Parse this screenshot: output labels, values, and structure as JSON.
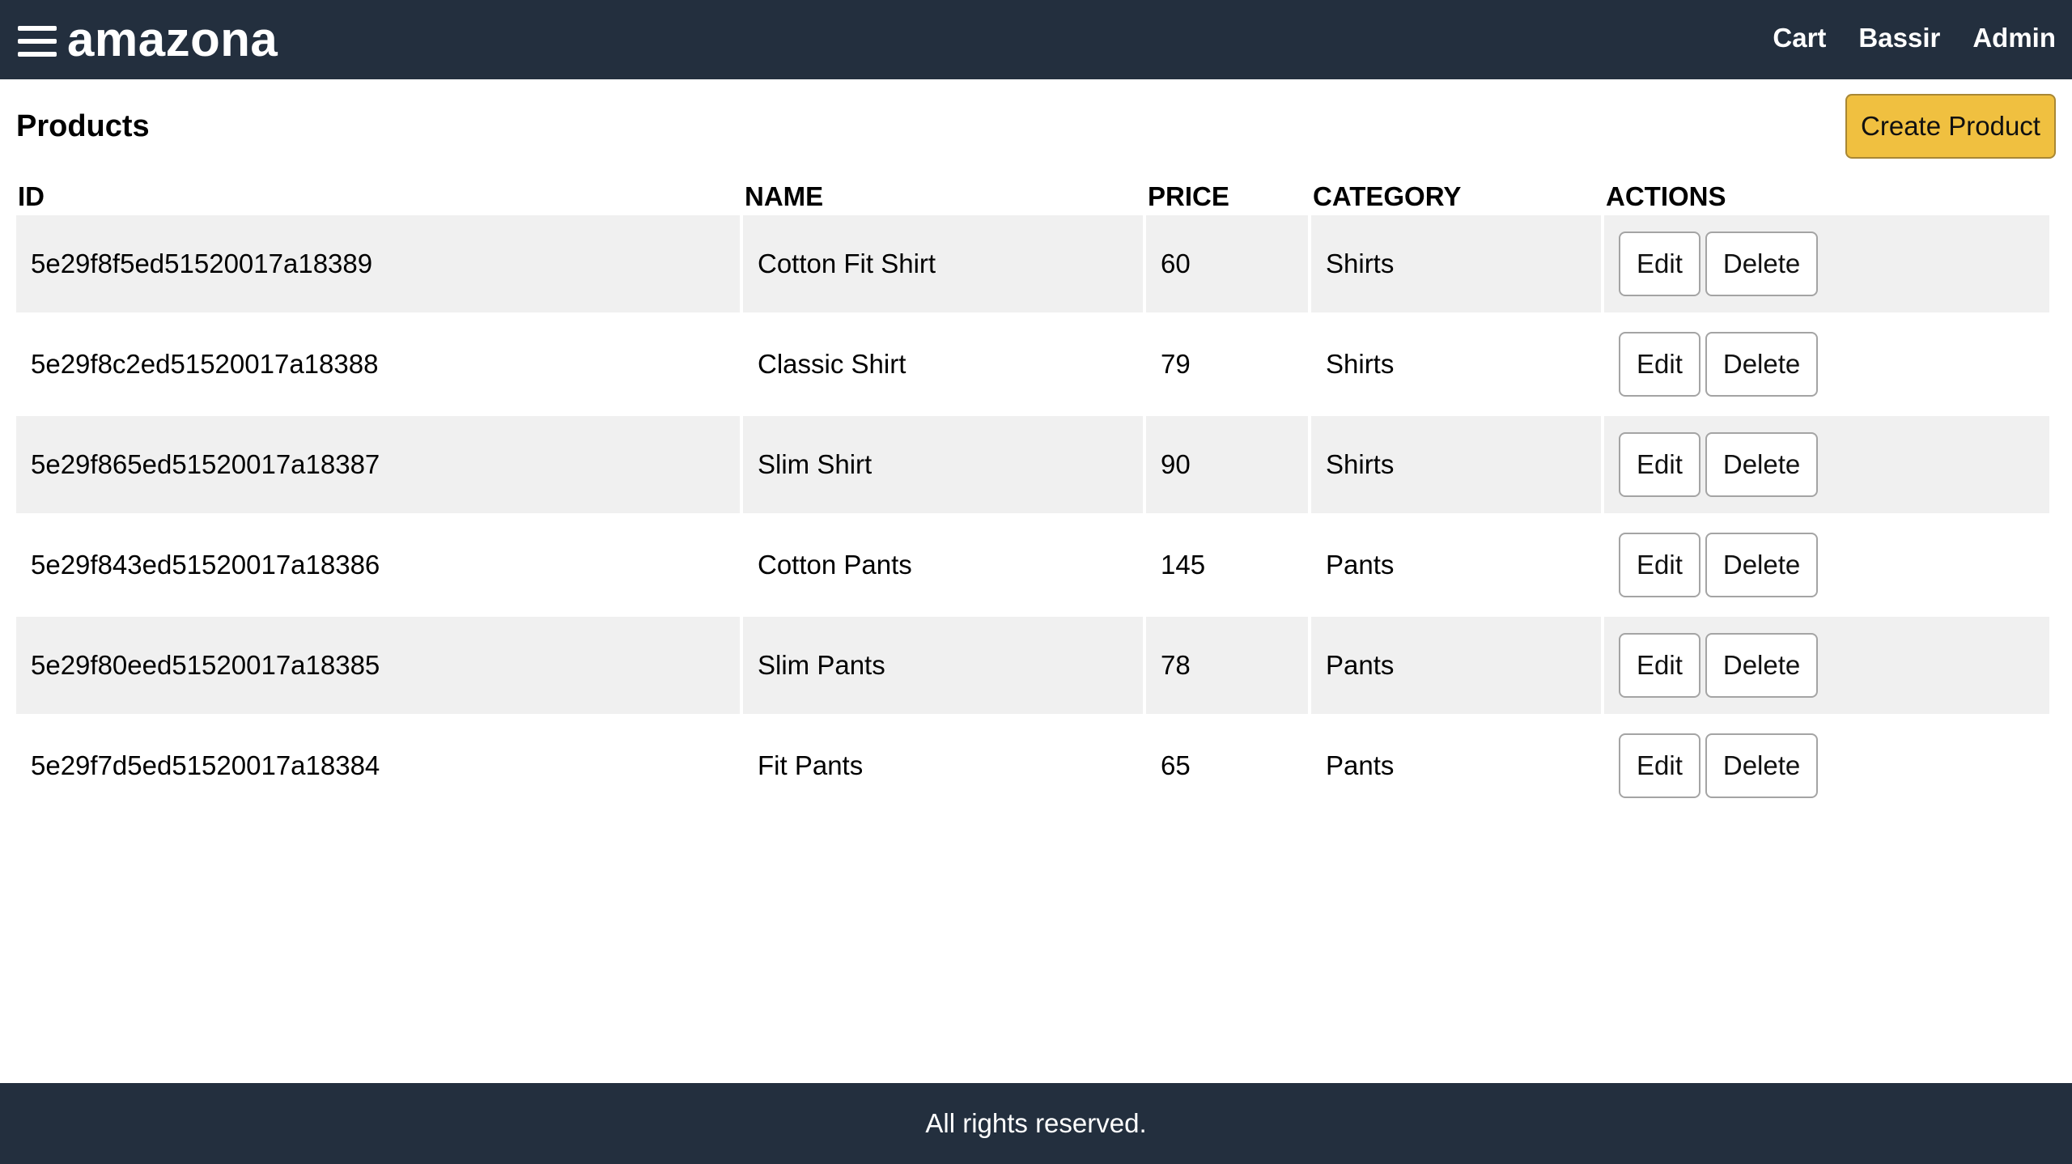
{
  "header": {
    "brand": "amazona",
    "menu_icon": "hamburger-menu-icon",
    "nav": {
      "cart": "Cart",
      "user": "Bassir",
      "admin": "Admin"
    }
  },
  "page": {
    "title": "Products",
    "create_button": "Create Product"
  },
  "table": {
    "headers": {
      "id": "ID",
      "name": "NAME",
      "price": "PRICE",
      "category": "CATEGORY",
      "actions": "ACTIONS"
    },
    "edit_label": "Edit",
    "delete_label": "Delete",
    "rows": [
      {
        "id": "5e29f8f5ed51520017a18389",
        "name": "Cotton Fit Shirt",
        "price": "60",
        "category": "Shirts"
      },
      {
        "id": "5e29f8c2ed51520017a18388",
        "name": "Classic Shirt",
        "price": "79",
        "category": "Shirts"
      },
      {
        "id": "5e29f865ed51520017a18387",
        "name": "Slim Shirt",
        "price": "90",
        "category": "Shirts"
      },
      {
        "id": "5e29f843ed51520017a18386",
        "name": "Cotton Pants",
        "price": "145",
        "category": "Pants"
      },
      {
        "id": "5e29f80eed51520017a18385",
        "name": "Slim Pants",
        "price": "78",
        "category": "Pants"
      },
      {
        "id": "5e29f7d5ed51520017a18384",
        "name": "Fit Pants",
        "price": "65",
        "category": "Pants"
      }
    ]
  },
  "footer": {
    "text": "All rights reserved."
  },
  "colors": {
    "header_bg": "#232f3e",
    "primary_button": "#f0c040",
    "row_stripe": "#f0f0f0"
  }
}
